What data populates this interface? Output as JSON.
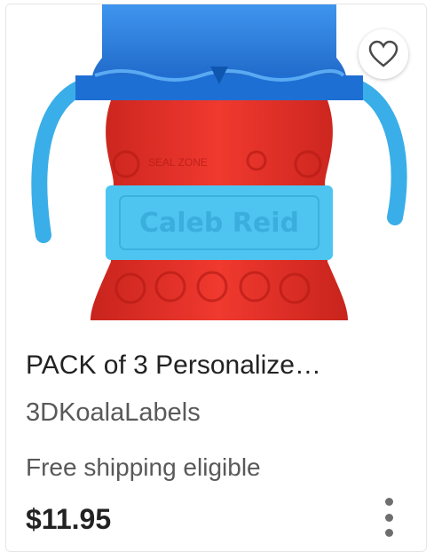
{
  "listing": {
    "title": "PACK of 3 Personalize…",
    "shop_name": "3DKoalaLabels",
    "shipping": "Free shipping eligible",
    "price": "$11.95",
    "image_label_text": "Caleb Reid",
    "image_embossed_text": "SEAL ZONE",
    "favorite_icon": "heart-outline-icon",
    "more_icon": "vertical-ellipsis-icon",
    "colors": {
      "cup_red": "#e8312b",
      "lid_blue": "#1e72d6",
      "band_light_blue": "#4ec5f0"
    }
  }
}
